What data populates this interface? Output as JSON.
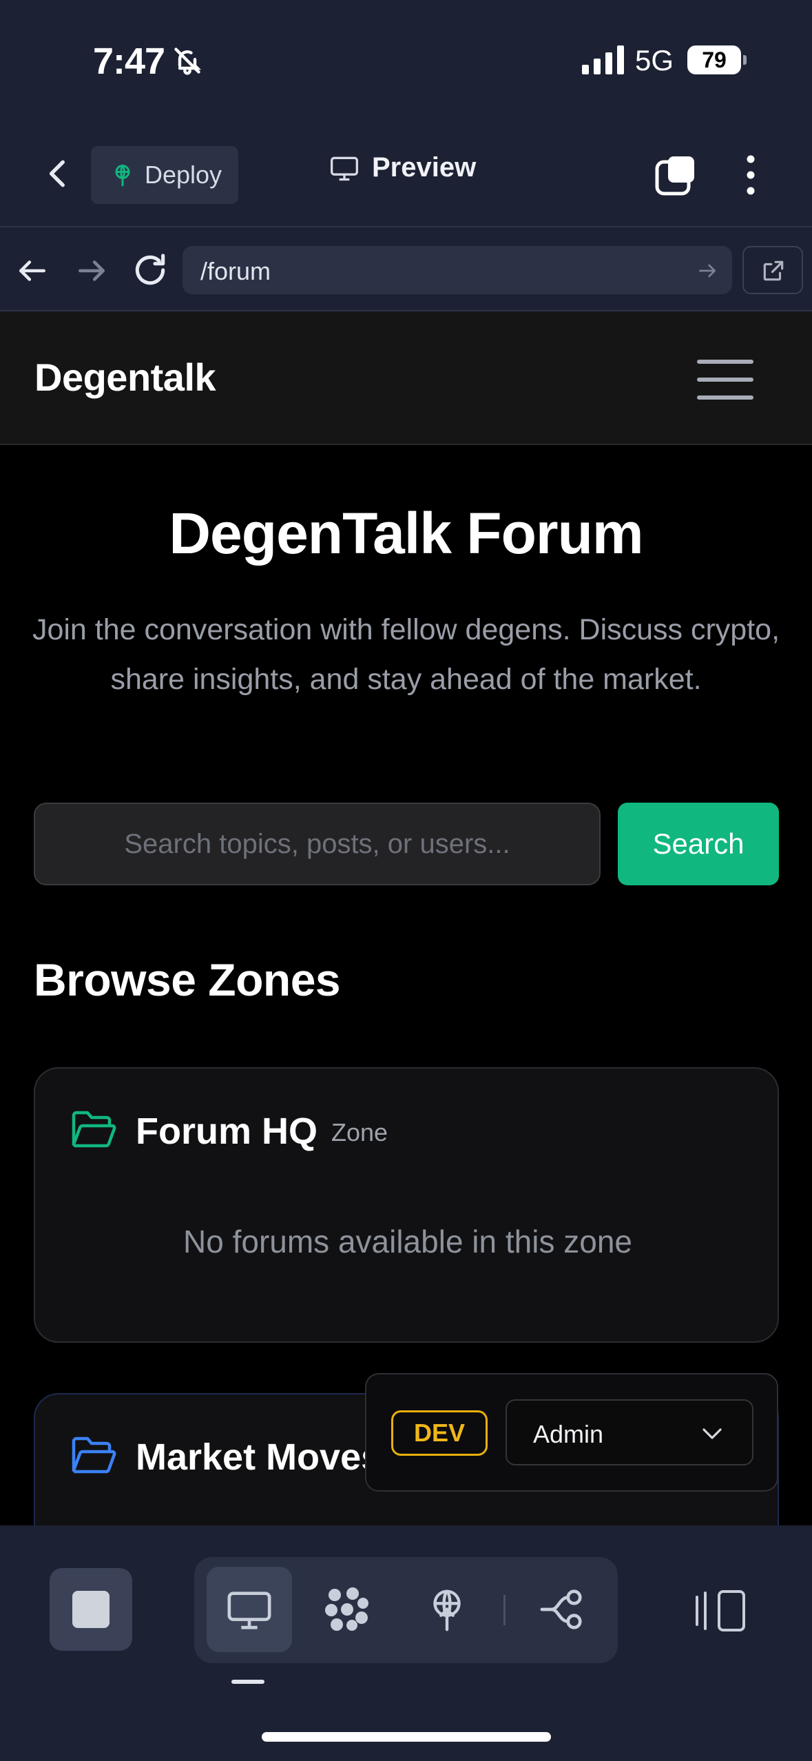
{
  "status_bar": {
    "time": "7:47",
    "network": "5G",
    "battery": "79"
  },
  "app_toolbar": {
    "deploy_label": "Deploy",
    "preview_label": "Preview"
  },
  "browser": {
    "url": "/forum"
  },
  "site": {
    "brand": "Degentalk"
  },
  "hero": {
    "title": "DegenTalk Forum",
    "subtitle": "Join the conversation with fellow degens. Discuss crypto, share insights, and stay ahead of the market."
  },
  "search": {
    "placeholder": "Search topics, posts, or users...",
    "button_label": "Search"
  },
  "zones_section": {
    "title": "Browse Zones",
    "zones": [
      {
        "name": "Forum HQ",
        "tag": "Zone",
        "empty_text": "No forums available in this zone",
        "icon_color": "#10b77f"
      },
      {
        "name": "Market Moves",
        "icon_color": "#3b82f6"
      }
    ]
  },
  "dev_panel": {
    "badge": "DEV",
    "role": "Admin"
  },
  "colors": {
    "accent": "#10b77f",
    "dev_badge": "#e9b00e",
    "chrome_bg": "#1c2133"
  }
}
